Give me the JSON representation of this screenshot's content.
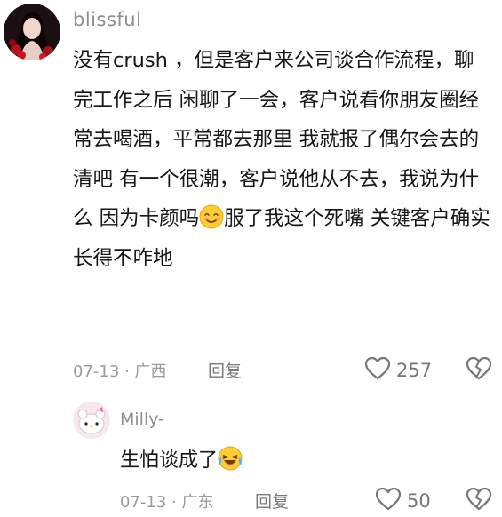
{
  "comment": {
    "username": "blissful",
    "text_part1": "没有crush ，但是客户来公司谈合作流程，聊完工作之后 闲聊了一会，客户说看你朋友圈经常去喝酒，平常都去那里 我就报了偶尔会去的清吧 有一个很潮，客户说他从不去，我说为什么 因为卡颜吗",
    "emoji": "blush-emoji",
    "text_part2": "服了我这个死嘴 关键客户确实长得不咋地",
    "date": "07-13",
    "location": "广西",
    "reply_label": "回复",
    "likes": "257"
  },
  "reply": {
    "username": "Milly-",
    "text": "生怕谈成了",
    "emoji": "crying-laughing-emoji",
    "date": "07-13",
    "location": "广东",
    "reply_label": "回复",
    "likes": "50"
  },
  "separator": " · ",
  "colors": {
    "meta": "#9a9a9a",
    "text": "#161616",
    "icon": "#777777"
  }
}
